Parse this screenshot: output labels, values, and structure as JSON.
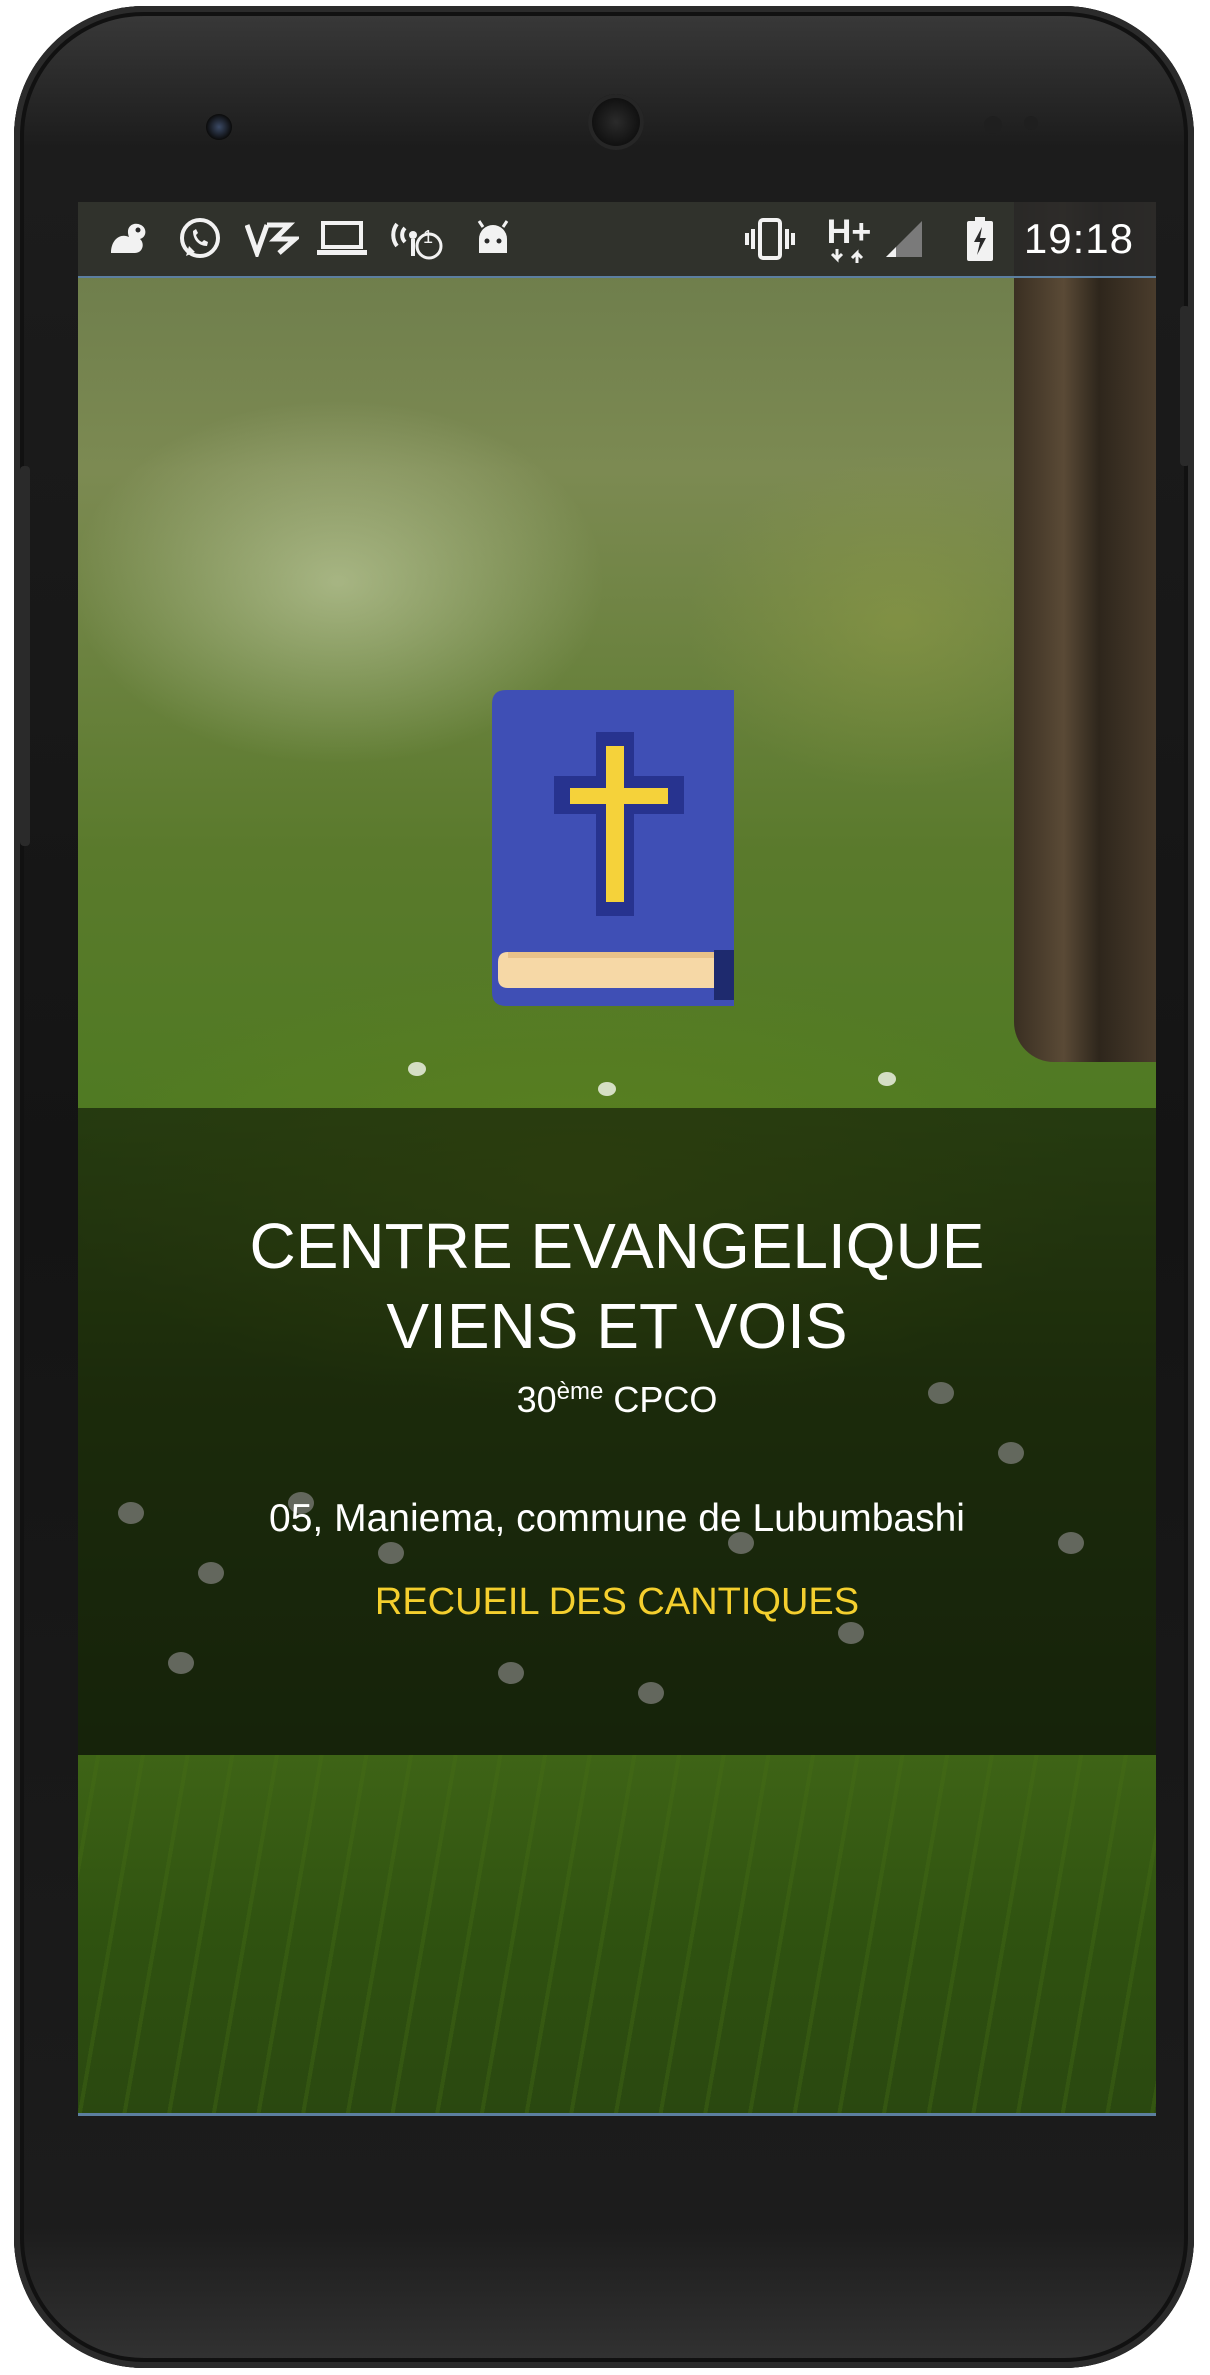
{
  "status_bar": {
    "time": "19:18",
    "network_type": "H+",
    "icons": [
      "uc-browser-icon",
      "whatsapp-icon",
      "vidmate-icon",
      "laptop-icon",
      "wifi-hotspot-icon",
      "android-debug-icon",
      "vibrate-icon",
      "network-icon",
      "signal-icon",
      "battery-charging-icon"
    ],
    "hotspot_count": "1"
  },
  "app": {
    "title_line1": "CENTRE EVANGELIQUE",
    "title_line2": "VIENS ET VOIS",
    "subtitle_number": "30",
    "subtitle_sup": "ème",
    "subtitle_rest": " CPCO",
    "address": "05, Maniema, commune de Lubumbashi",
    "link": "RECUEIL DES CANTIQUES",
    "logo_icon": "bible-cross-icon"
  },
  "colors": {
    "link": "#F4CF2E",
    "book_cover": "#3F4FB5",
    "cross": "#F5D23A"
  }
}
